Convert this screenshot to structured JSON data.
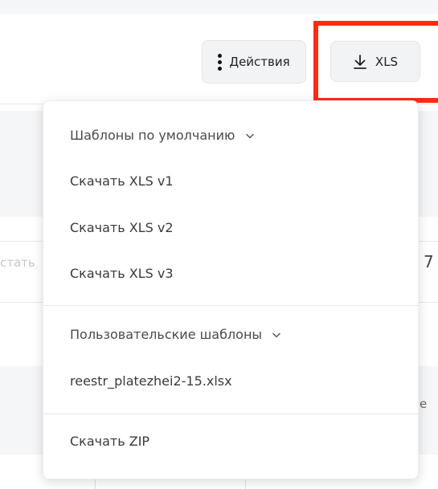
{
  "toolbar": {
    "actions_label": "Действия",
    "xls_label": "XLS"
  },
  "background": {
    "left_text": "стать",
    "right_text": "7",
    "right_text2": "е"
  },
  "dropdown": {
    "default_group_label": "Шаблоны по умолчанию",
    "default_items": [
      "Скачать XLS v1",
      "Скачать XLS v2",
      "Скачать XLS v3"
    ],
    "user_group_label": "Пользовательские шаблоны",
    "user_items": [
      "reestr_platezhei2-15.xlsx"
    ],
    "zip_label": "Скачать ZIP"
  },
  "colors": {
    "highlight": "#ff2a17",
    "button_bg": "#f2f3f5"
  }
}
